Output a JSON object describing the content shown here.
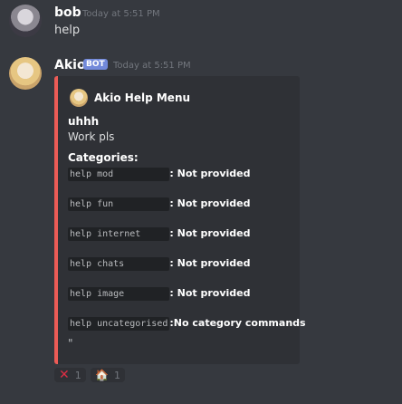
{
  "messages": [
    {
      "username": "bob",
      "timestamp": "Today at 5:51 PM",
      "content": "help"
    },
    {
      "username": "Akio",
      "badge": "BOT",
      "timestamp": "Today at 5:51 PM",
      "embed": {
        "accent_color": "#ec5b56",
        "author": "Akio Help Menu",
        "title": "uhhh",
        "description": "Work pls",
        "field_name": "Categories:",
        "categories": [
          {
            "code": "help mod          ",
            "value": "Not provided"
          },
          {
            "code": "help fun          ",
            "value": "Not provided"
          },
          {
            "code": "help internet     ",
            "value": "Not provided"
          },
          {
            "code": "help chats        ",
            "value": "Not provided"
          },
          {
            "code": "help image        ",
            "value": "Not provided"
          },
          {
            "code": "help uncategorised",
            "value": "No category commands"
          }
        ],
        "trailing_text": "\""
      },
      "reactions": [
        {
          "emoji": "cross-mark-icon",
          "count": "1"
        },
        {
          "emoji": "house-icon",
          "count": "1"
        }
      ]
    }
  ]
}
